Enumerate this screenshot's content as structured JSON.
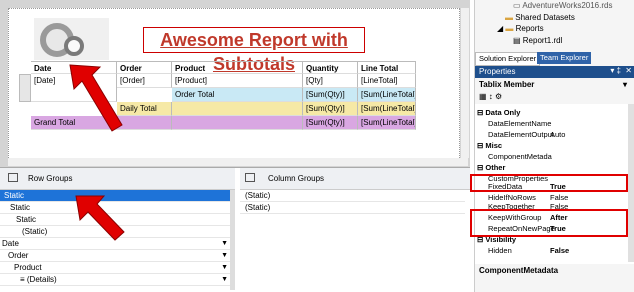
{
  "report": {
    "title": "Awesome Report with Subtotals",
    "headers": [
      "Date",
      "Order",
      "Product",
      "Quantity",
      "Line Total"
    ],
    "detail_row": [
      "[Date]",
      "[Order]",
      "[Product]",
      "[Qty]",
      "[LineTotal]"
    ],
    "order_total_row": [
      "",
      "",
      "Order Total",
      "[Sum(Qty)]",
      "[Sum(LineTotal)]"
    ],
    "daily_total_row": [
      "",
      "Daily Total",
      "",
      "[Sum(Qty)]",
      "[Sum(LineTotal)]"
    ],
    "grand_total_row": [
      "Grand Total",
      "",
      "",
      "[Sum(Qty)]",
      "[Sum(LineTotal)]"
    ],
    "colors": {
      "order_total": "#c9e9f5",
      "daily_total": "#f6e9a6",
      "grand_total": "#d9a7e2",
      "arrow": "#e00000"
    }
  },
  "row_groups": {
    "label": "Row Groups",
    "items": [
      "Static",
      "Static",
      "Static",
      "(Static)",
      "Date",
      "Order",
      "Product",
      "≡ (Details)"
    ],
    "selected_index": 0
  },
  "column_groups": {
    "label": "Column Groups",
    "items": [
      "(Static)",
      "(Static)"
    ]
  },
  "solution_explorer": {
    "items": [
      "AdventureWorks2016.rds",
      "Shared Datasets",
      "Reports",
      "Report1.rdl"
    ],
    "tabs": [
      "Solution Explorer",
      "Team Explorer"
    ]
  },
  "properties": {
    "title": "Properties",
    "object": "Tablix Member",
    "sections": [
      {
        "name": "Data Only",
        "rows": [
          [
            "DataElementName",
            ""
          ],
          [
            "DataElementOutput",
            "Auto"
          ]
        ]
      },
      {
        "name": "Misc",
        "rows": [
          [
            "ComponentMetada",
            ""
          ]
        ]
      },
      {
        "name": "Other",
        "rows": [
          [
            "CustomProperties",
            ""
          ],
          [
            "FixedData",
            "True"
          ],
          [
            "HideIfNoRows",
            "False"
          ],
          [
            "KeepTogether",
            "False"
          ],
          [
            "KeepWithGroup",
            "After"
          ],
          [
            "RepeatOnNewPage",
            "True"
          ]
        ]
      },
      {
        "name": "Visibility",
        "rows": [
          [
            "Hidden",
            "False"
          ]
        ]
      }
    ],
    "footer": "ComponentMetadata"
  }
}
